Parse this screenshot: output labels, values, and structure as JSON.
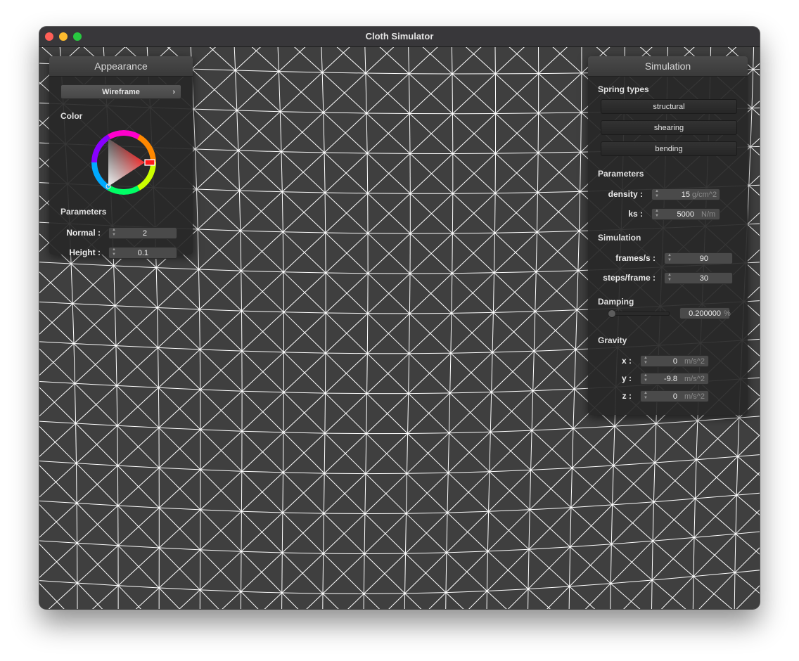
{
  "window": {
    "title": "Cloth Simulator"
  },
  "appearance": {
    "header": "Appearance",
    "shader_select": "Wireframe",
    "color_label": "Color",
    "parameters_label": "Parameters",
    "normal_label": "Normal :",
    "normal_value": "2",
    "height_label": "Height :",
    "height_value": "0.1"
  },
  "simulation": {
    "header": "Simulation",
    "spring_types_label": "Spring types",
    "spring_buttons": [
      "structural",
      "shearing",
      "bending"
    ],
    "parameters_label": "Parameters",
    "density_label": "density :",
    "density_value": "15",
    "density_unit": "g/cm^2",
    "ks_label": "ks :",
    "ks_value": "5000",
    "ks_unit": "N/m",
    "simulation_label": "Simulation",
    "fps_label": "frames/s :",
    "fps_value": "90",
    "steps_label": "steps/frame :",
    "steps_value": "30",
    "damping_label": "Damping",
    "damping_value": "0.200000",
    "damping_unit": "%",
    "damping_level": 0.2,
    "gravity_label": "Gravity",
    "gx_label": "x :",
    "gx_value": "0",
    "gy_label": "y :",
    "gy_value": "-9.8",
    "gz_label": "z :",
    "gz_value": "0",
    "gravity_unit": "m/s^2"
  },
  "icons": {
    "spin": "spinner-arrows-icon",
    "chevron": "chevron-right-icon",
    "color_wheel": "color-wheel-icon"
  },
  "colors": {
    "background": "#3f3f3f",
    "wire": "#ffffff",
    "selected_color": "#ff0000"
  }
}
